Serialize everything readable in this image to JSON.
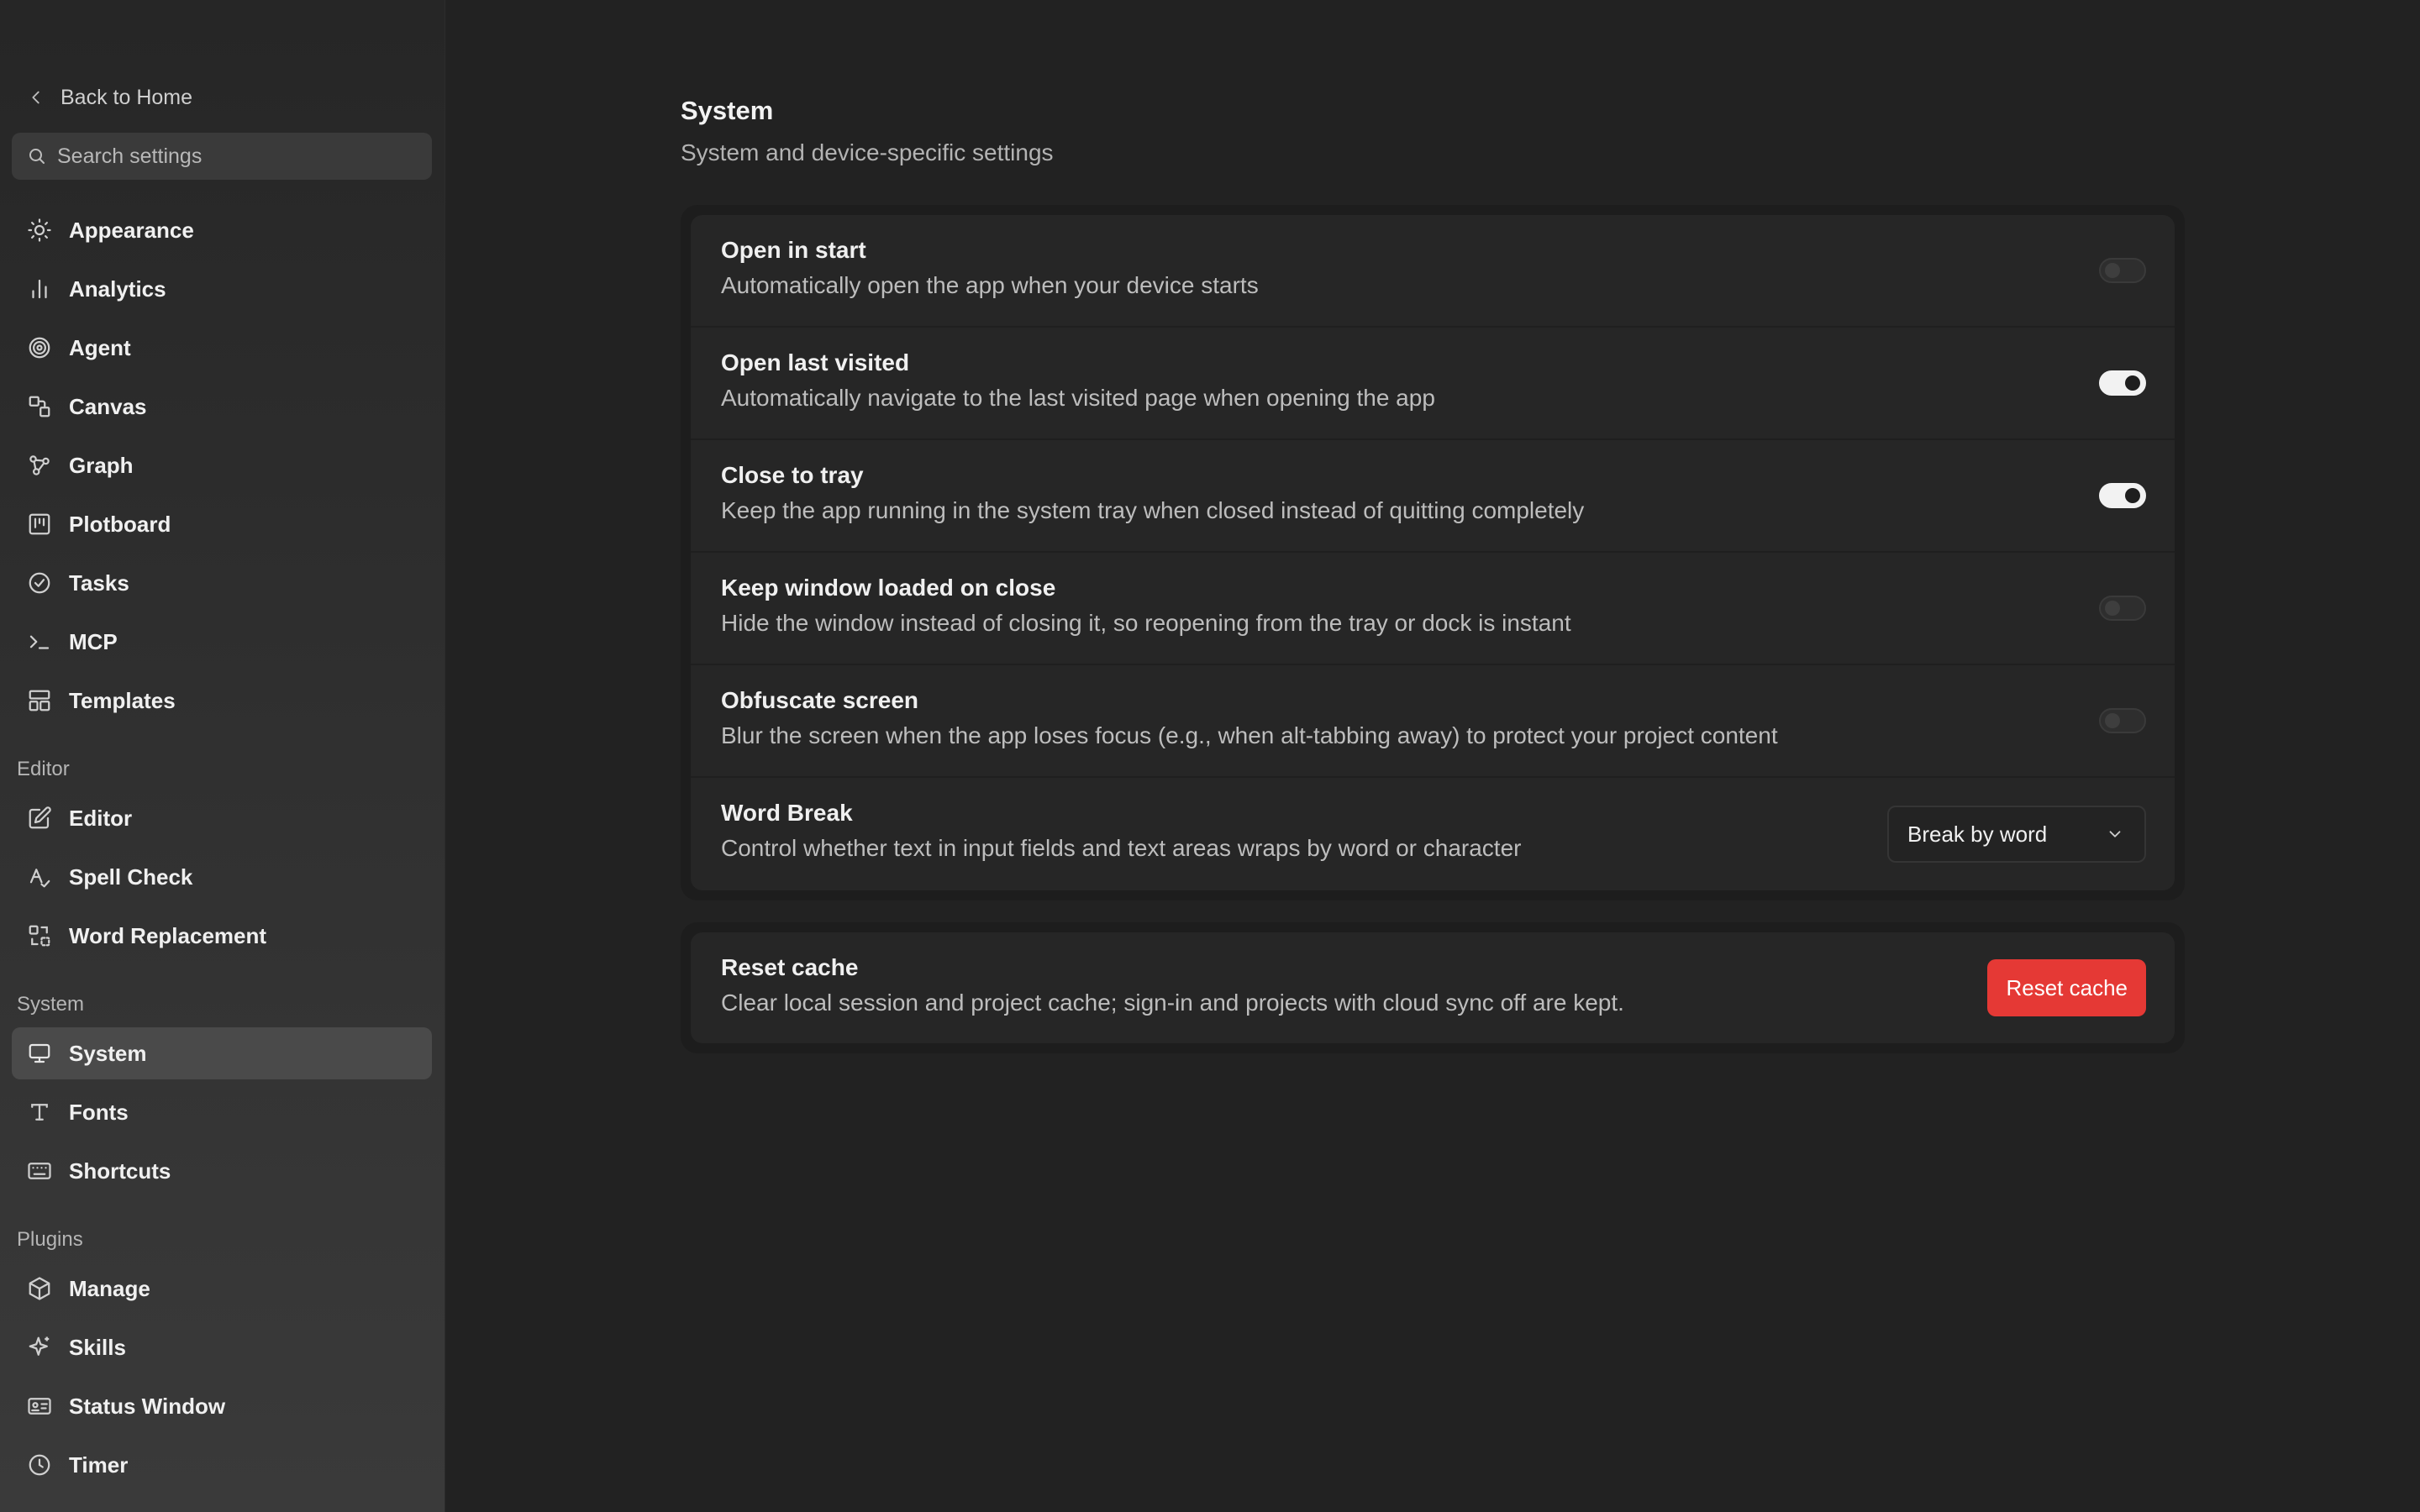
{
  "sidebar": {
    "back_label": "Back to Home",
    "search_placeholder": "Search settings",
    "items": [
      {
        "label": "Appearance",
        "icon": "sun-icon"
      },
      {
        "label": "Analytics",
        "icon": "bar-chart-icon"
      },
      {
        "label": "Agent",
        "icon": "spiral-icon"
      },
      {
        "label": "Canvas",
        "icon": "shapes-icon"
      },
      {
        "label": "Graph",
        "icon": "graph-nodes-icon"
      },
      {
        "label": "Plotboard",
        "icon": "kanban-icon"
      },
      {
        "label": "Tasks",
        "icon": "check-circle-icon"
      },
      {
        "label": "MCP",
        "icon": "terminal-icon"
      },
      {
        "label": "Templates",
        "icon": "layout-icon"
      }
    ],
    "sections": {
      "editor": {
        "title": "Editor",
        "items": [
          {
            "label": "Editor",
            "icon": "edit-icon"
          },
          {
            "label": "Spell Check",
            "icon": "spell-check-icon"
          },
          {
            "label": "Word Replacement",
            "icon": "replace-icon"
          }
        ]
      },
      "system": {
        "title": "System",
        "items": [
          {
            "label": "System",
            "icon": "monitor-icon",
            "active": true
          },
          {
            "label": "Fonts",
            "icon": "type-icon"
          },
          {
            "label": "Shortcuts",
            "icon": "keyboard-icon"
          }
        ]
      },
      "plugins": {
        "title": "Plugins",
        "items": [
          {
            "label": "Manage",
            "icon": "package-icon"
          },
          {
            "label": "Skills",
            "icon": "sparkles-icon"
          },
          {
            "label": "Status Window",
            "icon": "id-card-icon"
          },
          {
            "label": "Timer",
            "icon": "clock-icon"
          }
        ]
      }
    }
  },
  "page": {
    "title": "System",
    "subtitle": "System and device-specific settings"
  },
  "settings": [
    {
      "title": "Open in start",
      "desc": "Automatically open the app when your device starts",
      "enabled": false
    },
    {
      "title": "Open last visited",
      "desc": "Automatically navigate to the last visited page when opening the app",
      "enabled": true
    },
    {
      "title": "Close to tray",
      "desc": "Keep the app running in the system tray when closed instead of quitting completely",
      "enabled": true
    },
    {
      "title": "Keep window loaded on close",
      "desc": "Hide the window instead of closing it, so reopening from the tray or dock is instant",
      "enabled": false
    },
    {
      "title": "Obfuscate screen",
      "desc": "Blur the screen when the app loses focus (e.g., when alt-tabbing away) to protect your project content",
      "enabled": false
    },
    {
      "title": "Word Break",
      "desc": "Control whether text in input fields and text areas wraps by word or character",
      "select_value": "Break by word"
    }
  ],
  "reset": {
    "title": "Reset cache",
    "desc": "Clear local session and project cache; sign-in and projects with cloud sync off are kept.",
    "button_label": "Reset cache",
    "button_color": "#e53935"
  }
}
